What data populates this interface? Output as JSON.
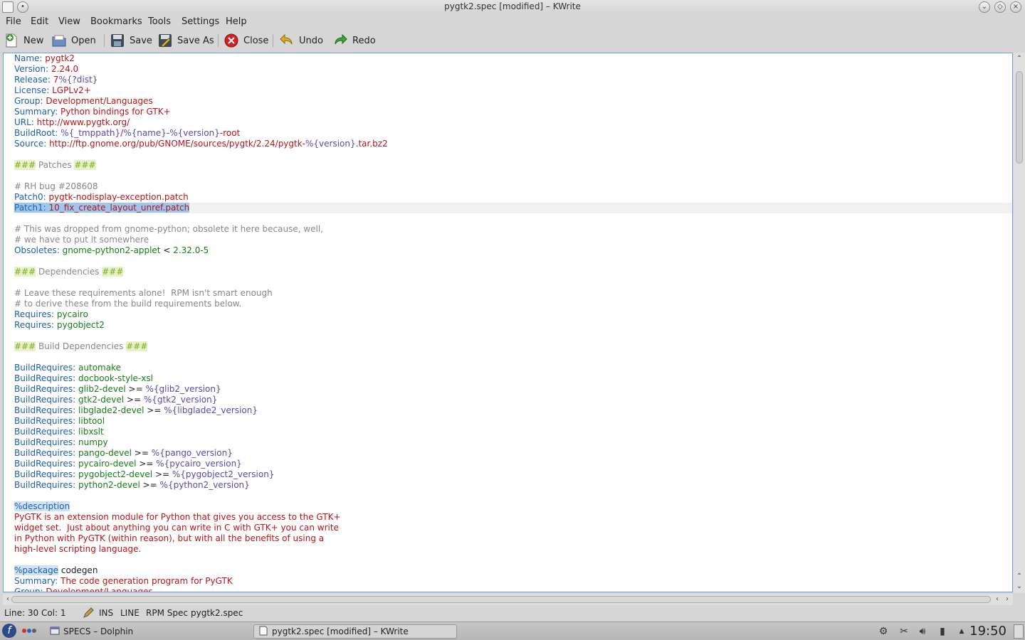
{
  "window": {
    "title": "pygtk2.spec [modified] – KWrite"
  },
  "menubar": {
    "items": [
      "File",
      "Edit",
      "View",
      "Bookmarks",
      "Tools",
      "Settings",
      "Help"
    ]
  },
  "toolbar": {
    "new_label": "New",
    "open_label": "Open",
    "save_label": "Save",
    "saveas_label": "Save As",
    "close_label": "Close",
    "undo_label": "Undo",
    "redo_label": "Redo"
  },
  "editor": {
    "lines": [
      [
        [
          "c-key",
          "Name: "
        ],
        [
          "c-red",
          "pygtk2"
        ]
      ],
      [
        [
          "c-key",
          "Version: "
        ],
        [
          "c-red",
          "2.24.0"
        ]
      ],
      [
        [
          "c-key",
          "Release: "
        ],
        [
          "c-red",
          "7"
        ],
        [
          "c-var",
          "%{?dist}"
        ]
      ],
      [
        [
          "c-key",
          "License: "
        ],
        [
          "c-red",
          "LGPLv2+"
        ]
      ],
      [
        [
          "c-key",
          "Group: "
        ],
        [
          "c-red",
          "Development/Languages"
        ]
      ],
      [
        [
          "c-key",
          "Summary: "
        ],
        [
          "c-red",
          "Python bindings for GTK+"
        ]
      ],
      [
        [
          "c-key",
          "URL: "
        ],
        [
          "c-red",
          "http://www.pygtk.org/"
        ]
      ],
      [
        [
          "c-key",
          "BuildRoot: "
        ],
        [
          "c-var",
          "%{_tmppath}"
        ],
        [
          "c-red",
          "/"
        ],
        [
          "c-var",
          "%{name}"
        ],
        [
          "c-red",
          "-"
        ],
        [
          "c-var",
          "%{version}"
        ],
        [
          "c-red",
          "-root"
        ]
      ],
      [
        [
          "c-key",
          "Source: "
        ],
        [
          "c-red",
          "http://ftp.gnome.org/pub/GNOME/sources/pygtk/2.24/pygtk-"
        ],
        [
          "c-var",
          "%{version}"
        ],
        [
          "c-red",
          ".tar.bz2"
        ]
      ],
      [],
      [
        [
          "c-hash",
          "###"
        ],
        [
          "c-hdr",
          " Patches "
        ],
        [
          "c-hash",
          "###"
        ]
      ],
      [],
      [
        [
          "c-cmt",
          "# RH bug #208608"
        ]
      ],
      [
        [
          "c-key",
          "Patch0: "
        ],
        [
          "c-red",
          "pygtk-nodisplay-exception.patch"
        ]
      ],
      [
        [
          "sel c-key",
          "Patch1: "
        ],
        [
          "sel c-red",
          "10_fix_create_layout_unref.patch"
        ]
      ],
      [],
      [
        [
          "c-cmt",
          "# This was dropped from gnome-python; obsolete it here because, well,"
        ]
      ],
      [
        [
          "c-cmt",
          "# we have to put it somewhere"
        ]
      ],
      [
        [
          "c-key",
          "Obsoletes: "
        ],
        [
          "c-green",
          "gnome-python2-applet "
        ],
        [
          "c-op",
          "< "
        ],
        [
          "c-green",
          "2.32.0-5"
        ]
      ],
      [],
      [
        [
          "c-hash",
          "###"
        ],
        [
          "c-hdr",
          " Dependencies "
        ],
        [
          "c-hash",
          "###"
        ]
      ],
      [],
      [
        [
          "c-cmt",
          "# Leave these requirements alone!  RPM isn't smart enough"
        ]
      ],
      [
        [
          "c-cmt",
          "# to derive these from the build requirements below."
        ]
      ],
      [
        [
          "c-key",
          "Requires: "
        ],
        [
          "c-green",
          "pycairo"
        ]
      ],
      [
        [
          "c-key",
          "Requires: "
        ],
        [
          "c-green",
          "pygobject2"
        ]
      ],
      [],
      [
        [
          "c-hash",
          "###"
        ],
        [
          "c-hdr",
          " Build Dependencies "
        ],
        [
          "c-hash",
          "###"
        ]
      ],
      [],
      [
        [
          "c-key",
          "BuildRequires: "
        ],
        [
          "c-green",
          "automake"
        ]
      ],
      [
        [
          "c-key",
          "BuildRequires: "
        ],
        [
          "c-green",
          "docbook-style-xsl"
        ]
      ],
      [
        [
          "c-key",
          "BuildRequires: "
        ],
        [
          "c-green",
          "glib2-devel "
        ],
        [
          "c-op",
          ">= "
        ],
        [
          "c-var",
          "%{glib2_version}"
        ]
      ],
      [
        [
          "c-key",
          "BuildRequires: "
        ],
        [
          "c-green",
          "gtk2-devel "
        ],
        [
          "c-op",
          ">= "
        ],
        [
          "c-var",
          "%{gtk2_version}"
        ]
      ],
      [
        [
          "c-key",
          "BuildRequires: "
        ],
        [
          "c-green",
          "libglade2-devel "
        ],
        [
          "c-op",
          ">= "
        ],
        [
          "c-var",
          "%{libglade2_version}"
        ]
      ],
      [
        [
          "c-key",
          "BuildRequires: "
        ],
        [
          "c-green",
          "libtool"
        ]
      ],
      [
        [
          "c-key",
          "BuildRequires: "
        ],
        [
          "c-green",
          "libxslt"
        ]
      ],
      [
        [
          "c-key",
          "BuildRequires: "
        ],
        [
          "c-green",
          "numpy"
        ]
      ],
      [
        [
          "c-key",
          "BuildRequires: "
        ],
        [
          "c-green",
          "pango-devel "
        ],
        [
          "c-op",
          ">= "
        ],
        [
          "c-var",
          "%{pango_version}"
        ]
      ],
      [
        [
          "c-key",
          "BuildRequires: "
        ],
        [
          "c-green",
          "pycairo-devel "
        ],
        [
          "c-op",
          ">= "
        ],
        [
          "c-var",
          "%{pycairo_version}"
        ]
      ],
      [
        [
          "c-key",
          "BuildRequires: "
        ],
        [
          "c-green",
          "pygobject2-devel "
        ],
        [
          "c-op",
          ">= "
        ],
        [
          "c-var",
          "%{pygobject2_version}"
        ]
      ],
      [
        [
          "c-key",
          "BuildRequires: "
        ],
        [
          "c-green",
          "python2-devel "
        ],
        [
          "c-op",
          ">= "
        ],
        [
          "c-var",
          "%{python2_version}"
        ]
      ],
      [],
      [
        [
          "c-sec",
          "%description"
        ]
      ],
      [
        [
          "c-red",
          "PyGTK is an extension module for Python that gives you access to the GTK+"
        ]
      ],
      [
        [
          "c-red",
          "widget set.  Just about anything you can write in C with GTK+ you can write"
        ]
      ],
      [
        [
          "c-red",
          "in Python with PyGTK (within reason), but with all the benefits of using a"
        ]
      ],
      [
        [
          "c-red",
          "high-level scripting language."
        ]
      ],
      [],
      [
        [
          "c-sec",
          "%package"
        ],
        [
          "c-op",
          " codegen"
        ]
      ],
      [
        [
          "c-key",
          "Summary: "
        ],
        [
          "c-red",
          "The code generation program for PyGTK"
        ]
      ],
      [
        [
          "c-key",
          "Group: "
        ],
        [
          "c-red",
          "Development/Languages"
        ]
      ]
    ],
    "current_line_index": 14
  },
  "statusbar": {
    "position": "Line: 30 Col: 1",
    "mode": "INS",
    "selection_mode": "LINE",
    "syntax": "RPM Spec",
    "filename": "pygtk2.spec"
  },
  "taskbar": {
    "tasks": [
      {
        "label": "SPECS – Dolphin",
        "active": false
      },
      {
        "label": "pygtk2.spec [modified] – KWrite",
        "active": true
      }
    ],
    "clock": "19:50"
  }
}
